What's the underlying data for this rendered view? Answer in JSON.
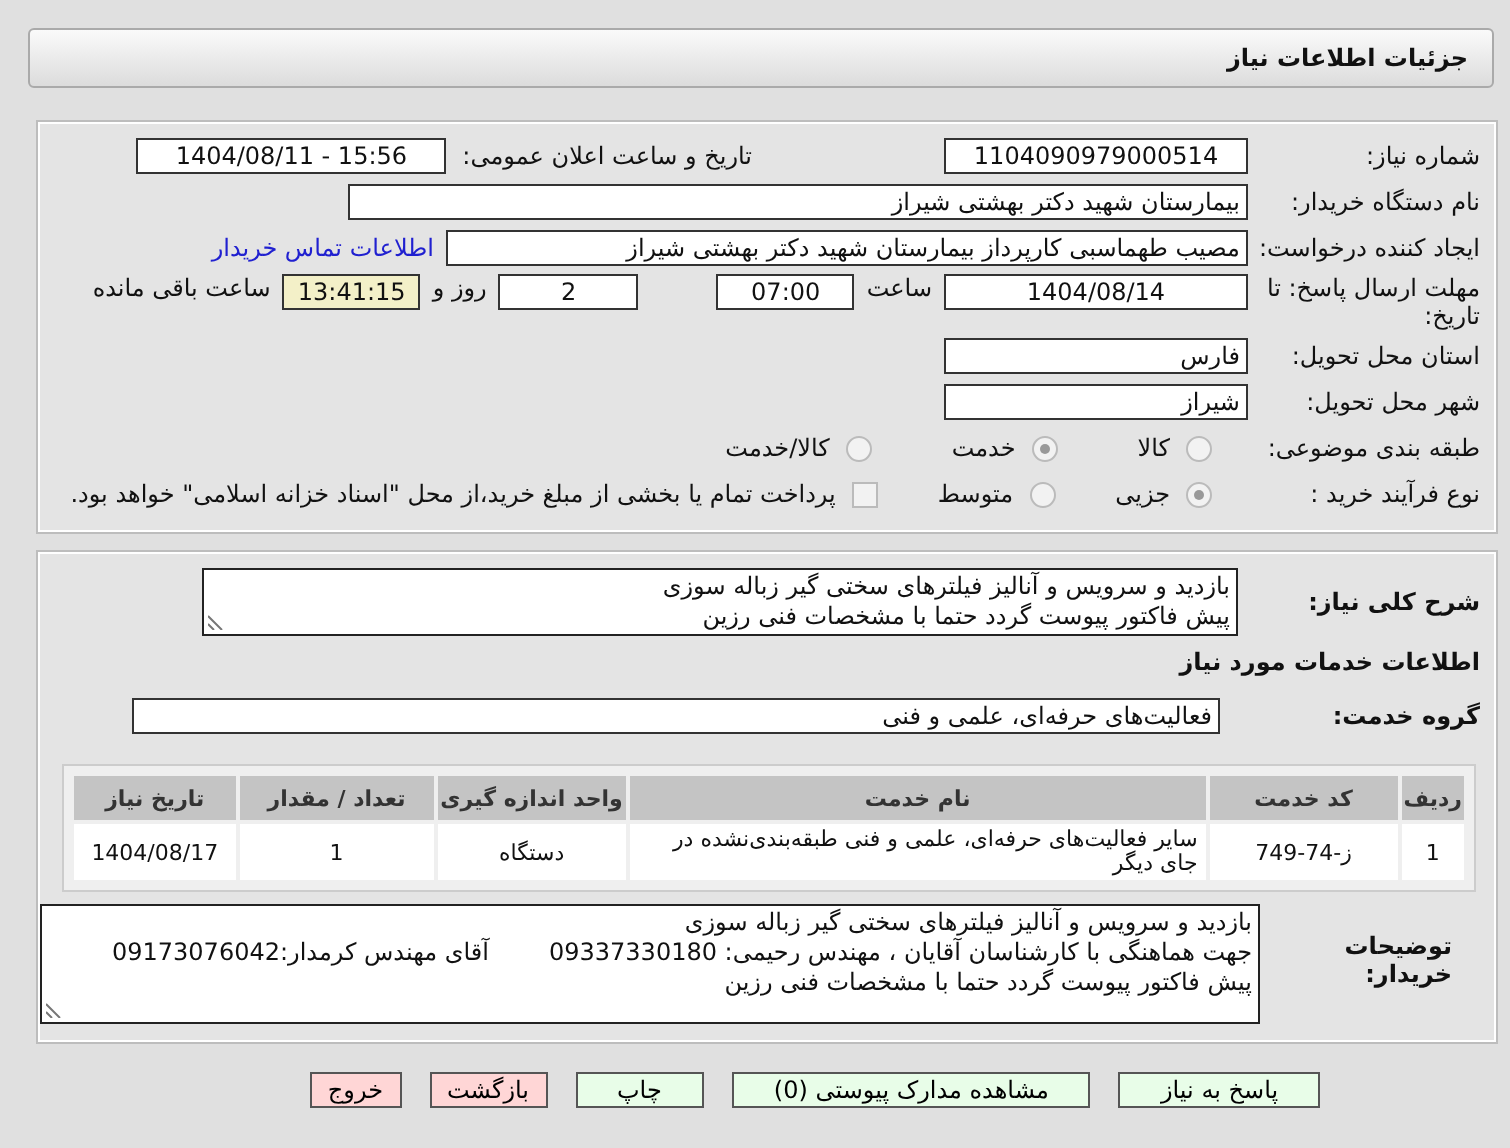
{
  "header": {
    "title": "جزئیات اطلاعات نیاز"
  },
  "need_number": {
    "label": "شماره نیاز:",
    "value": "1104090979000514"
  },
  "announce": {
    "label": "تاریخ و ساعت اعلان عمومی:",
    "value": "1404/08/11 - 15:56"
  },
  "buyer_org": {
    "label": "نام دستگاه خریدار:",
    "value": "بیمارستان شهید دکتر بهشتی شیراز"
  },
  "requester": {
    "label": "ایجاد کننده درخواست:",
    "value": "مصیب طهماسبی کارپرداز بیمارستان شهید دکتر بهشتی شیراز",
    "link": "اطلاعات تماس خریدار"
  },
  "deadline": {
    "label": "مهلت ارسال پاسخ: تا تاریخ:",
    "date": "1404/08/14",
    "time_label": "ساعت",
    "time": "07:00",
    "days": "2",
    "days_label": "روز و",
    "remaining": "13:41:15",
    "remaining_label": "ساعت باقی مانده"
  },
  "province": {
    "label": "استان محل تحویل:",
    "value": "فارس"
  },
  "city": {
    "label": "شهر محل تحویل:",
    "value": "شیراز"
  },
  "category": {
    "label": "طبقه بندی موضوعی:",
    "options": [
      {
        "kind": "radio",
        "label": "کالا",
        "selected": false
      },
      {
        "kind": "radio",
        "label": "خدمت",
        "selected": true
      },
      {
        "kind": "radio",
        "label": "کالا/خدمت",
        "selected": false
      }
    ]
  },
  "process": {
    "label": "نوع فرآیند خرید :",
    "options": [
      {
        "kind": "radio",
        "label": "جزیی",
        "selected": true
      },
      {
        "kind": "radio",
        "label": "متوسط",
        "selected": false
      },
      {
        "kind": "checkbox",
        "label": "پرداخت تمام یا بخشی از مبلغ خرید،از محل \"اسناد خزانه اسلامی\" خواهد بود.",
        "checked": false
      }
    ]
  },
  "description": {
    "label": "شرح کلی نیاز:",
    "lines": [
      "بازدید و سرویس و آنالیز فیلترهای سختی گیر زباله سوزی",
      "پیش فاکتور پیوست گردد حتما با مشخصات فنی رزین"
    ]
  },
  "services_title": "اطلاعات خدمات مورد نیاز",
  "service_group": {
    "label": "گروه خدمت:",
    "value": "فعالیت‌های حرفه‌ای، علمی و فنی"
  },
  "table": {
    "columns": [
      "ردیف",
      "کد خدمت",
      "نام خدمت",
      "واحد اندازه گیری",
      "تعداد / مقدار",
      "تاریخ نیاز"
    ],
    "rows": [
      [
        "1",
        "ز-74-749",
        "سایر فعالیت‌های حرفه‌ای، علمی و فنی طبقه‌بندی‌نشده در جای دیگر",
        "دستگاه",
        "1",
        "1404/08/17"
      ]
    ]
  },
  "notes": {
    "label": "توضیحات خریدار:",
    "lines": [
      [
        "بازدید و سرویس و آنالیز فیلترهای سختی گیر زباله سوزی"
      ],
      [
        "جهت هماهنگی با کارشناسان آقایان ، مهندس رحیمی: 09337330180",
        "آقای مهندس کرمدار:09173076042"
      ],
      [
        "پیش فاکتور پیوست گردد حتما با مشخصات فنی رزین"
      ]
    ]
  },
  "buttons": [
    {
      "label": "پاسخ به نیاز",
      "kind": "normal"
    },
    {
      "label": "مشاهده مدارک پیوستی (0)",
      "kind": "normal"
    },
    {
      "label": "چاپ",
      "kind": "normal"
    },
    {
      "label": "بازگشت",
      "kind": "danger"
    },
    {
      "label": "خروج",
      "kind": "danger"
    }
  ]
}
